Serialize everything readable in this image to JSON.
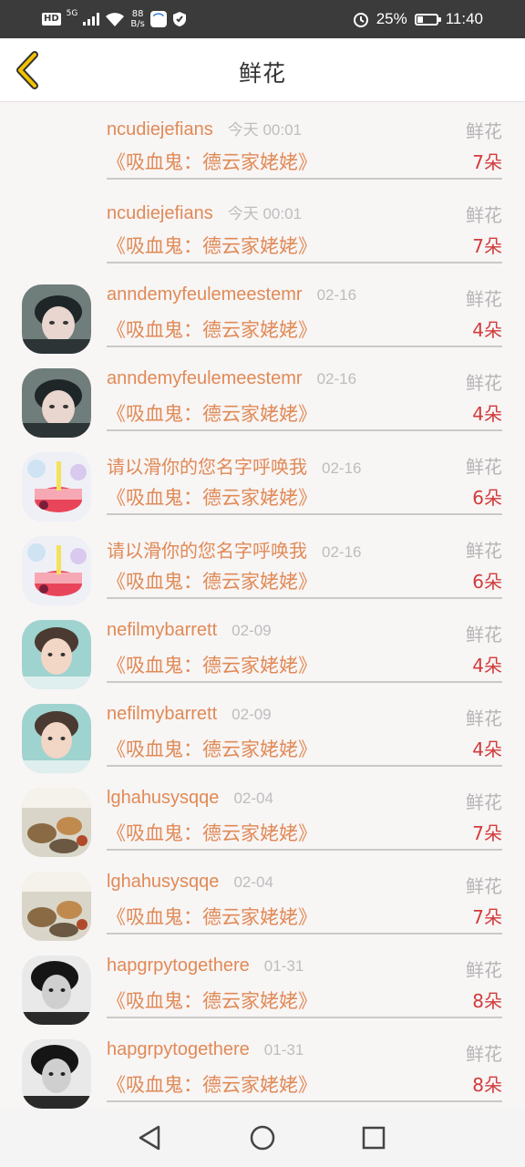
{
  "status_bar": {
    "hd": "HD",
    "signal": "5G",
    "net_speed_value": "88",
    "net_speed_unit": "B/s",
    "battery": "25%",
    "time": "11:40"
  },
  "header": {
    "title": "鲜花"
  },
  "records": [
    {
      "user": "ncudiejefians",
      "time": "今天 00:01",
      "type": "鲜花",
      "work": "《吸血鬼：德云家姥姥》",
      "count": "7朵",
      "avatar": "none"
    },
    {
      "user": "ncudiejefians",
      "time": "今天 00:01",
      "type": "鲜花",
      "work": "《吸血鬼：德云家姥姥》",
      "count": "7朵",
      "avatar": "none"
    },
    {
      "user": "anndemyfeulemeestemr",
      "time": "02-16",
      "type": "鲜花",
      "work": "《吸血鬼：德云家姥姥》",
      "count": "4朵",
      "avatar": "boy-selfie"
    },
    {
      "user": "anndemyfeulemeestemr",
      "time": "02-16",
      "type": "鲜花",
      "work": "《吸血鬼：德云家姥姥》",
      "count": "4朵",
      "avatar": "boy-selfie"
    },
    {
      "user": "请以滑你的您名字呼唤我",
      "time": "02-16",
      "type": "鲜花",
      "work": "《吸血鬼：德云家姥姥》",
      "count": "6朵",
      "avatar": "birthday-cake"
    },
    {
      "user": "请以滑你的您名字呼唤我",
      "time": "02-16",
      "type": "鲜花",
      "work": "《吸血鬼：德云家姥姥》",
      "count": "6朵",
      "avatar": "birthday-cake"
    },
    {
      "user": "nefilmybarrett",
      "time": "02-09",
      "type": "鲜花",
      "work": "《吸血鬼：德云家姥姥》",
      "count": "4朵",
      "avatar": "boy-portrait"
    },
    {
      "user": "nefilmybarrett",
      "time": "02-09",
      "type": "鲜花",
      "work": "《吸血鬼：德云家姥姥》",
      "count": "4朵",
      "avatar": "boy-portrait"
    },
    {
      "user": "lghahusysqqe",
      "time": "02-04",
      "type": "鲜花",
      "work": "《吸血鬼：德云家姥姥》",
      "count": "7朵",
      "avatar": "food-table"
    },
    {
      "user": "lghahusysqqe",
      "time": "02-04",
      "type": "鲜花",
      "work": "《吸血鬼：德云家姥姥》",
      "count": "7朵",
      "avatar": "food-table"
    },
    {
      "user": "hapgrpytogethere",
      "time": "01-31",
      "type": "鲜花",
      "work": "《吸血鬼：德云家姥姥》",
      "count": "8朵",
      "avatar": "boy-bw"
    },
    {
      "user": "hapgrpytogethere",
      "time": "01-31",
      "type": "鲜花",
      "work": "《吸血鬼：德云家姥姥》",
      "count": "8朵",
      "avatar": "boy-bw"
    }
  ],
  "colors": {
    "username": "#e08a56",
    "time": "#bdbdbd",
    "type": "#b5b5b5",
    "count": "#d23b3b",
    "back_arrow": "#f2c200"
  }
}
